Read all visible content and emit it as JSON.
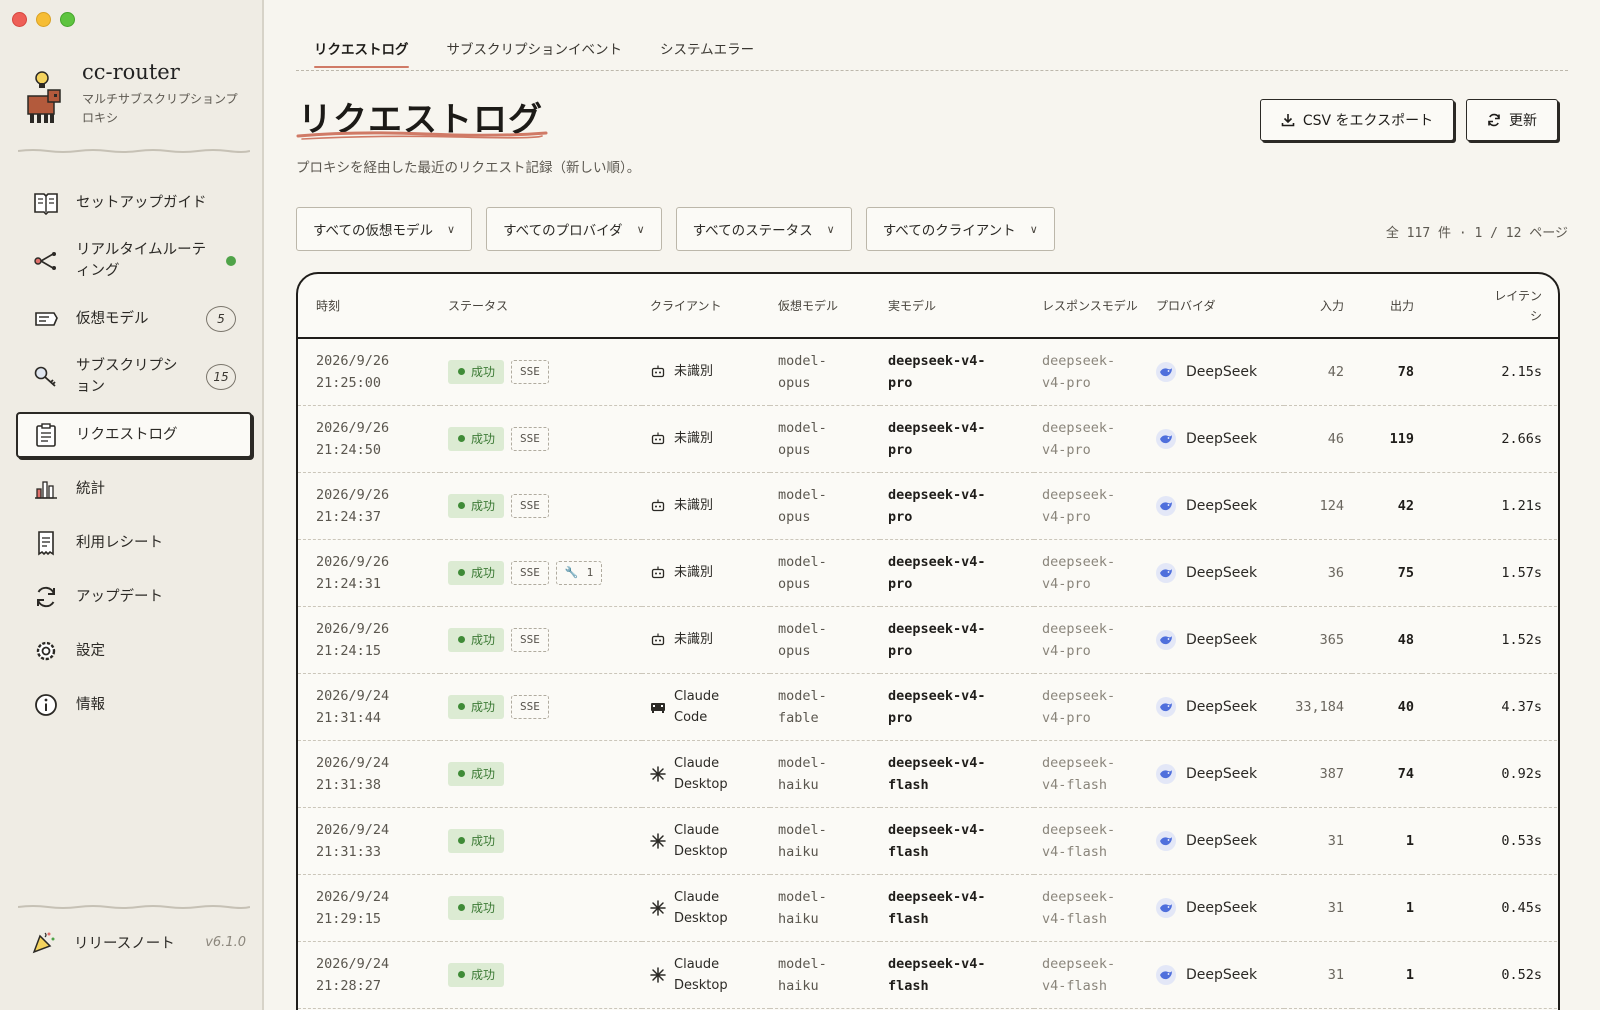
{
  "app": {
    "name": "cc-router",
    "subtitle": "マルチサブスクリプションプロキシ",
    "version": "v6.1.0",
    "release_label": "リリースノート"
  },
  "sidebar": {
    "items": [
      {
        "label": "セットアップガイド",
        "icon": "book-icon"
      },
      {
        "label": "リアルタイムルーティング",
        "icon": "route-icon"
      },
      {
        "label": "仮想モデル",
        "icon": "model-icon",
        "count": "5"
      },
      {
        "label": "サブスクリプション",
        "icon": "key-icon",
        "count": "15"
      },
      {
        "label": "リクエストログ",
        "icon": "clipboard-icon"
      },
      {
        "label": "統計",
        "icon": "bar-chart-icon"
      },
      {
        "label": "利用レシート",
        "icon": "receipt-icon"
      },
      {
        "label": "アップデート",
        "icon": "refresh-icon"
      },
      {
        "label": "設定",
        "icon": "gear-icon"
      },
      {
        "label": "情報",
        "icon": "info-icon"
      }
    ]
  },
  "tabs": [
    {
      "label": "リクエストログ"
    },
    {
      "label": "サブスクリプションイベント"
    },
    {
      "label": "システムエラー"
    }
  ],
  "page": {
    "title": "リクエストログ",
    "subtitle": "プロキシを経由した最近のリクエスト記録（新しい順）。",
    "export_label": "CSV をエクスポート",
    "refresh_label": "更新"
  },
  "filters": [
    {
      "label": "すべての仮想モデル"
    },
    {
      "label": "すべてのプロバイダ"
    },
    {
      "label": "すべてのステータス"
    },
    {
      "label": "すべてのクライアント"
    }
  ],
  "pager": "全 117 件 · 1 / 12 ページ",
  "table": {
    "headers": [
      "時刻",
      "ステータス",
      "クライアント",
      "仮想モデル",
      "実モデル",
      "レスポンスモデル",
      "プロバイダ",
      "入力",
      "出力",
      "レイテンシ"
    ],
    "rows": [
      {
        "date": "2026/9/26",
        "time": "21:25:00",
        "status": "成功",
        "sse": "SSE",
        "tool": "",
        "client1": "未識別",
        "client2": "",
        "vm1": "model-",
        "vm2": "opus",
        "rm1": "deepseek-v4-",
        "rm2": "pro",
        "resp1": "deepseek-",
        "resp2": "v4-pro",
        "provider": "DeepSeek",
        "input": "42",
        "output": "78",
        "latency": "2.15s"
      },
      {
        "date": "2026/9/26",
        "time": "21:24:50",
        "status": "成功",
        "sse": "SSE",
        "tool": "",
        "client1": "未識別",
        "client2": "",
        "vm1": "model-",
        "vm2": "opus",
        "rm1": "deepseek-v4-",
        "rm2": "pro",
        "resp1": "deepseek-",
        "resp2": "v4-pro",
        "provider": "DeepSeek",
        "input": "46",
        "output": "119",
        "latency": "2.66s"
      },
      {
        "date": "2026/9/26",
        "time": "21:24:37",
        "status": "成功",
        "sse": "SSE",
        "tool": "",
        "client1": "未識別",
        "client2": "",
        "vm1": "model-",
        "vm2": "opus",
        "rm1": "deepseek-v4-",
        "rm2": "pro",
        "resp1": "deepseek-",
        "resp2": "v4-pro",
        "provider": "DeepSeek",
        "input": "124",
        "output": "42",
        "latency": "1.21s"
      },
      {
        "date": "2026/9/26",
        "time": "21:24:31",
        "status": "成功",
        "sse": "SSE",
        "tool": "1",
        "client1": "未識別",
        "client2": "",
        "vm1": "model-",
        "vm2": "opus",
        "rm1": "deepseek-v4-",
        "rm2": "pro",
        "resp1": "deepseek-",
        "resp2": "v4-pro",
        "provider": "DeepSeek",
        "input": "36",
        "output": "75",
        "latency": "1.57s"
      },
      {
        "date": "2026/9/26",
        "time": "21:24:15",
        "status": "成功",
        "sse": "SSE",
        "tool": "",
        "client1": "未識別",
        "client2": "",
        "vm1": "model-",
        "vm2": "opus",
        "rm1": "deepseek-v4-",
        "rm2": "pro",
        "resp1": "deepseek-",
        "resp2": "v4-pro",
        "provider": "DeepSeek",
        "input": "365",
        "output": "48",
        "latency": "1.52s"
      },
      {
        "date": "2026/9/24",
        "time": "21:31:44",
        "status": "成功",
        "sse": "SSE",
        "tool": "",
        "client1": "Claude",
        "client2": "Code",
        "vm1": "model-",
        "vm2": "fable",
        "rm1": "deepseek-v4-",
        "rm2": "pro",
        "resp1": "deepseek-",
        "resp2": "v4-pro",
        "provider": "DeepSeek",
        "input": "33,184",
        "output": "40",
        "latency": "4.37s"
      },
      {
        "date": "2026/9/24",
        "time": "21:31:38",
        "status": "成功",
        "sse": "",
        "tool": "",
        "client1": "Claude",
        "client2": "Desktop",
        "vm1": "model-",
        "vm2": "haiku",
        "rm1": "deepseek-v4-",
        "rm2": "flash",
        "resp1": "deepseek-",
        "resp2": "v4-flash",
        "provider": "DeepSeek",
        "input": "387",
        "output": "74",
        "latency": "0.92s"
      },
      {
        "date": "2026/9/24",
        "time": "21:31:33",
        "status": "成功",
        "sse": "",
        "tool": "",
        "client1": "Claude",
        "client2": "Desktop",
        "vm1": "model-",
        "vm2": "haiku",
        "rm1": "deepseek-v4-",
        "rm2": "flash",
        "resp1": "deepseek-",
        "resp2": "v4-flash",
        "provider": "DeepSeek",
        "input": "31",
        "output": "1",
        "latency": "0.53s"
      },
      {
        "date": "2026/9/24",
        "time": "21:29:15",
        "status": "成功",
        "sse": "",
        "tool": "",
        "client1": "Claude",
        "client2": "Desktop",
        "vm1": "model-",
        "vm2": "haiku",
        "rm1": "deepseek-v4-",
        "rm2": "flash",
        "resp1": "deepseek-",
        "resp2": "v4-flash",
        "provider": "DeepSeek",
        "input": "31",
        "output": "1",
        "latency": "0.45s"
      },
      {
        "date": "2026/9/24",
        "time": "21:28:27",
        "status": "成功",
        "sse": "",
        "tool": "",
        "client1": "Claude",
        "client2": "Desktop",
        "vm1": "model-",
        "vm2": "haiku",
        "rm1": "deepseek-v4-",
        "rm2": "flash",
        "resp1": "deepseek-",
        "resp2": "v4-flash",
        "provider": "DeepSeek",
        "input": "31",
        "output": "1",
        "latency": "0.52s"
      }
    ]
  }
}
